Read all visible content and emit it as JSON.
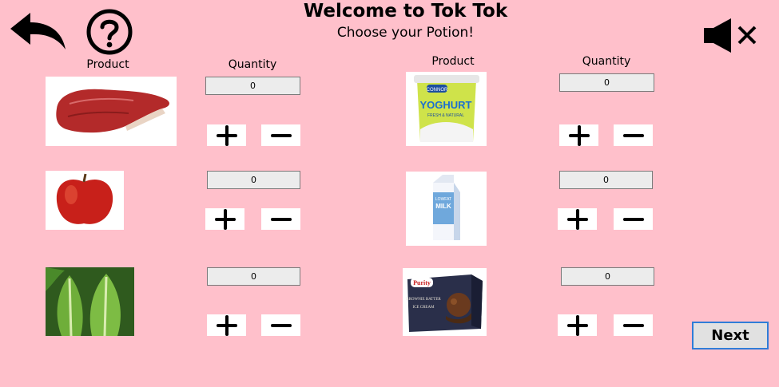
{
  "header": {
    "title": "Welcome to Tok Tok",
    "subtitle": "Choose your Potion!"
  },
  "icons": {
    "back": "back-arrow-icon",
    "help": "question-mark-icon",
    "sound": "mute-speaker-icon"
  },
  "columns": {
    "product_label": "Product",
    "quantity_label": "Quantity"
  },
  "products": [
    {
      "name": "steak",
      "quantity": "0"
    },
    {
      "name": "apple",
      "quantity": "0"
    },
    {
      "name": "lettuce",
      "quantity": "0"
    },
    {
      "name": "yoghurt",
      "quantity": "0",
      "image_text": [
        "CONNOR",
        "YOGHURT",
        "FRESH & NATURAL"
      ]
    },
    {
      "name": "milk",
      "quantity": "0",
      "image_text": [
        "LOWFAT",
        "MILK"
      ]
    },
    {
      "name": "ice-cream",
      "quantity": "0",
      "image_text": [
        "Purity",
        "BROWNIE BATTER",
        "ICE CREAM"
      ]
    }
  ],
  "buttons": {
    "next": "Next"
  }
}
